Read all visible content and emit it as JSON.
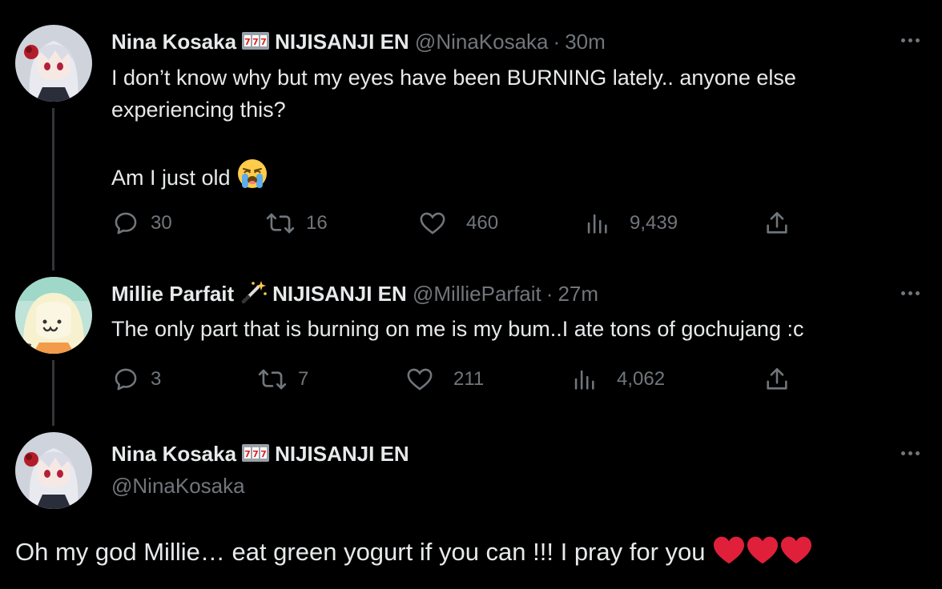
{
  "tweets": [
    {
      "name": "Nina Kosaka",
      "affiliation": "NIJISANJI EN",
      "handle": "@NinaKosaka",
      "separator": "·",
      "time": "30m",
      "line1": "I don’t know why but my eyes have been BURNING lately.. anyone else",
      "line2": "experiencing this?",
      "line3": "Am I just old",
      "emoji": "crying-face",
      "replies": "30",
      "retweets": "16",
      "likes": "460",
      "views": "9,439"
    },
    {
      "name": "Millie Parfait",
      "affiliation": "NIJISANJI EN",
      "handle": "@MillieParfait",
      "separator": "·",
      "time": "27m",
      "line1": "The only part that is burning on me is my bum..I ate tons of gochujang :c",
      "replies": "3",
      "retweets": "7",
      "likes": "211",
      "views": "4,062"
    },
    {
      "name": "Nina Kosaka",
      "affiliation": "NIJISANJI EN",
      "handle": "@NinaKosaka",
      "body": "Oh my god Millie… eat green yogurt if you can !!! I pray for you",
      "emoji": "red-heart x3"
    }
  ],
  "colors": {
    "background": "#000000",
    "text": "#e7e9ea",
    "secondary": "#71767b",
    "heart": "#e0203a"
  },
  "icons": [
    "reply-icon",
    "retweet-icon",
    "like-icon",
    "views-icon",
    "share-icon",
    "more-icon",
    "slot-machine-icon",
    "magic-wand-icon"
  ]
}
